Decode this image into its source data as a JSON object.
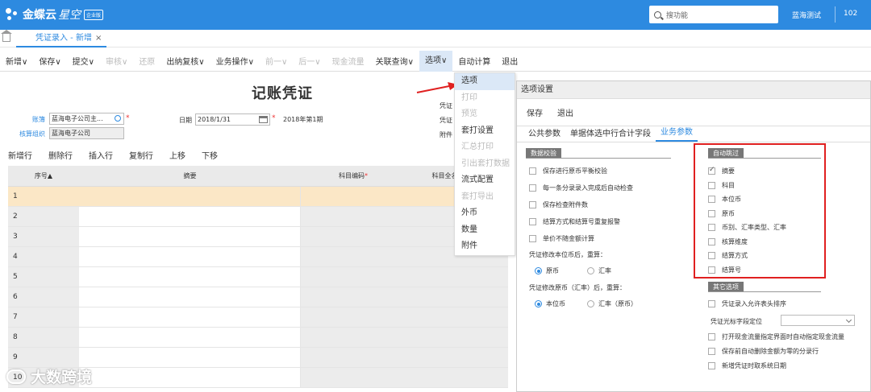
{
  "app": {
    "brand": "金蝶云",
    "brand_sub": "星空",
    "brand_badge": "企业版",
    "search_placeholder": "搜功能",
    "user": "蓝海测试",
    "account_code": "102"
  },
  "tab": {
    "label": "凭证录入 - 新增",
    "close": "×"
  },
  "toolbar": [
    {
      "label": "新增∨",
      "disabled": false
    },
    {
      "label": "保存∨",
      "disabled": false
    },
    {
      "label": "提交∨",
      "disabled": false
    },
    {
      "label": "审核∨",
      "disabled": true
    },
    {
      "label": "还原",
      "disabled": true
    },
    {
      "label": "出纳复核∨",
      "disabled": false
    },
    {
      "label": "业务操作∨",
      "disabled": false
    },
    {
      "label": "前一∨",
      "disabled": true
    },
    {
      "label": "后一∨",
      "disabled": true
    },
    {
      "label": "现金流量",
      "disabled": true
    },
    {
      "label": "关联查询∨",
      "disabled": false
    },
    {
      "label": "选项∨",
      "disabled": false,
      "active": true
    },
    {
      "label": "自动计算",
      "disabled": false
    },
    {
      "label": "退出",
      "disabled": false
    }
  ],
  "voucher": {
    "title": "记账凭证",
    "account_book_label": "账簿",
    "account_book_value": "蓝海电子公司主...",
    "accounting_org_label": "核算组织",
    "accounting_org_value": "蓝海电子公司",
    "date_label": "日期",
    "date_value": "2018/1/31",
    "period": "2018年第1期",
    "side_labels": [
      "凭证",
      "凭证",
      "附件"
    ]
  },
  "grid_toolbar": [
    "新增行",
    "删除行",
    "插入行",
    "复制行",
    "上移",
    "下移"
  ],
  "grid": {
    "headers": [
      "序号▲",
      "摘要",
      "科目编码",
      "科目全名"
    ],
    "rows": [
      "1",
      "2",
      "3",
      "4",
      "5",
      "6",
      "7",
      "8",
      "9",
      "10"
    ]
  },
  "options_menu": {
    "items": [
      {
        "label": "选项",
        "disabled": false,
        "highlight": true
      },
      {
        "label": "打印",
        "disabled": true
      },
      {
        "label": "预览",
        "disabled": true
      },
      {
        "label": "套打设置",
        "disabled": false
      },
      {
        "label": "汇总打印",
        "disabled": true
      },
      {
        "label": "引出套打数据",
        "disabled": true
      },
      {
        "label": "流式配置",
        "disabled": false
      },
      {
        "label": "套打导出",
        "disabled": true
      },
      {
        "label": "外币",
        "disabled": false
      },
      {
        "label": "数量",
        "disabled": false
      },
      {
        "label": "附件",
        "disabled": false
      }
    ]
  },
  "dialog": {
    "title": "选项设置",
    "buttons": [
      "保存",
      "退出"
    ],
    "tabs": [
      "公共参数",
      "单据体选中行合计字段",
      "业务参数"
    ],
    "active_tab": 2,
    "data_check": {
      "title": "数据校验",
      "items": [
        "保存进行原币平衡校验",
        "每一条分录录入完成后自动检查",
        "保存检查附件数",
        "结算方式和结算号重复报警",
        "单价不随金额计算"
      ]
    },
    "local_change": {
      "label": "凭证修改本位币后，重算：",
      "options": [
        "原币",
        "汇率"
      ],
      "selected": 0
    },
    "orig_change": {
      "label": "凭证修改原币（汇率）后，重算：",
      "options": [
        "本位币",
        "汇率（原币）"
      ],
      "selected": 0
    },
    "auto_skip": {
      "title": "自动跳过",
      "items": [
        {
          "label": "摘要",
          "checked": true
        },
        {
          "label": "科目",
          "checked": false
        },
        {
          "label": "本位币",
          "checked": false
        },
        {
          "label": "原币",
          "checked": false
        },
        {
          "label": "币别、汇率类型、汇率",
          "checked": false
        },
        {
          "label": "核算维度",
          "checked": false
        },
        {
          "label": "结算方式",
          "checked": false
        },
        {
          "label": "结算号",
          "checked": false
        }
      ]
    },
    "other": {
      "title": "其它选项",
      "items": [
        "凭证录入允许表头排序",
        "打开现金流量指定界面时自动指定现金流量",
        "保存前自动删除金额为零的分录行",
        "新增凭证时取系统日期"
      ],
      "cursor_label": "凭证光标字段定位"
    }
  },
  "watermark": "大数跨境",
  "colors": {
    "brand": "#2d8ae0",
    "highlight_row": "#fbe7c6",
    "annotation": "#e02020"
  }
}
